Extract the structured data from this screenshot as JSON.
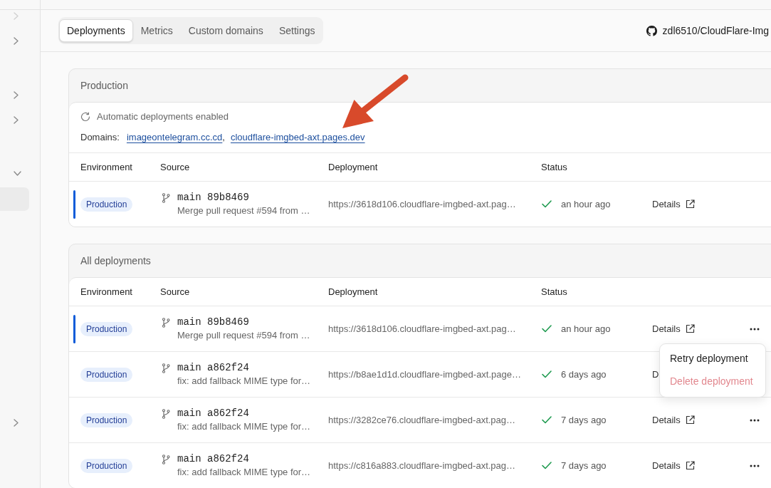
{
  "sidebar": {
    "sections": [
      {
        "items": [
          {
            "expanded": false,
            "disabled": true
          },
          {
            "expanded": false,
            "disabled": false
          }
        ]
      },
      {
        "items": [
          {
            "expanded": false,
            "disabled": false
          },
          {
            "expanded": false,
            "disabled": false
          }
        ]
      },
      {
        "items": [
          {
            "expanded": true,
            "disabled": false,
            "children": [
              {
                "selected": true
              }
            ]
          }
        ]
      },
      {
        "items": [
          {
            "expanded": false,
            "disabled": false
          }
        ]
      }
    ]
  },
  "tabs": [
    {
      "label": "Deployments",
      "selected": true
    },
    {
      "label": "Metrics",
      "selected": false
    },
    {
      "label": "Custom domains",
      "selected": false
    },
    {
      "label": "Settings",
      "selected": false
    }
  ],
  "repository": "zdl6510/CloudFlare-Img",
  "production": {
    "title": "Production",
    "auto_deploy": "Automatic deployments enabled",
    "domains_label": "Domains:",
    "domains": [
      {
        "link": "imageontelegram.cc.cd",
        "separator": ","
      },
      {
        "link": "cloudflare-imgbed-axt.pages.dev"
      }
    ],
    "table": {
      "columns": [
        "Environment",
        "Source",
        "Deployment",
        "Status"
      ],
      "rows": [
        {
          "current": true,
          "environment": "Production",
          "source": "main 89b8469",
          "message": "Merge pull request #594 from …",
          "url": "https://3618d106.cloudflare-imgbed-axt.pag…",
          "succeeded": true,
          "time": "an hour ago",
          "details": "Details",
          "details_icon": true,
          "more_button": false
        }
      ]
    }
  },
  "all_deployments": {
    "title": "All deployments",
    "table": {
      "columns": [
        "Environment",
        "Source",
        "Deployment",
        "Status"
      ],
      "rows": [
        {
          "current": true,
          "environment": "Production",
          "source": "main 89b8469",
          "message": "Merge pull request #594 from …",
          "url": "https://3618d106.cloudflare-imgbed-axt.pag…",
          "succeeded": true,
          "time": "an hour ago",
          "details": "Details",
          "details_icon": true,
          "more_button": true,
          "menu": {
            "items": [
              {
                "label": "Retry deployment",
                "kind": "normal"
              },
              {
                "label": "Delete deployment",
                "kind": "danger"
              }
            ]
          }
        },
        {
          "current": false,
          "environment": "Production",
          "source": "main a862f24",
          "message": "fix: add fallback MIME type for…",
          "url": "https://b8ae1d1d.cloudflare-imgbed-axt.page…",
          "succeeded": true,
          "time": "6 days ago",
          "details": "D",
          "details_icon": false,
          "more_button": false
        },
        {
          "current": false,
          "environment": "Production",
          "source": "main a862f24",
          "message": "fix: add fallback MIME type for…",
          "url": "https://3282ce76.cloudflare-imgbed-axt.pag…",
          "succeeded": true,
          "time": "7 days ago",
          "details": "Details",
          "details_icon": true,
          "more_button": true
        },
        {
          "current": false,
          "environment": "Production",
          "source": "main a862f24",
          "message": "fix: add fallback MIME type for…",
          "url": "https://c816a883.cloudflare-imgbed-axt.pag…",
          "succeeded": true,
          "time": "7 days ago",
          "details": "Details",
          "details_icon": true,
          "more_button": true
        }
      ]
    }
  },
  "annotations": [
    {
      "kind": "arrow"
    }
  ]
}
